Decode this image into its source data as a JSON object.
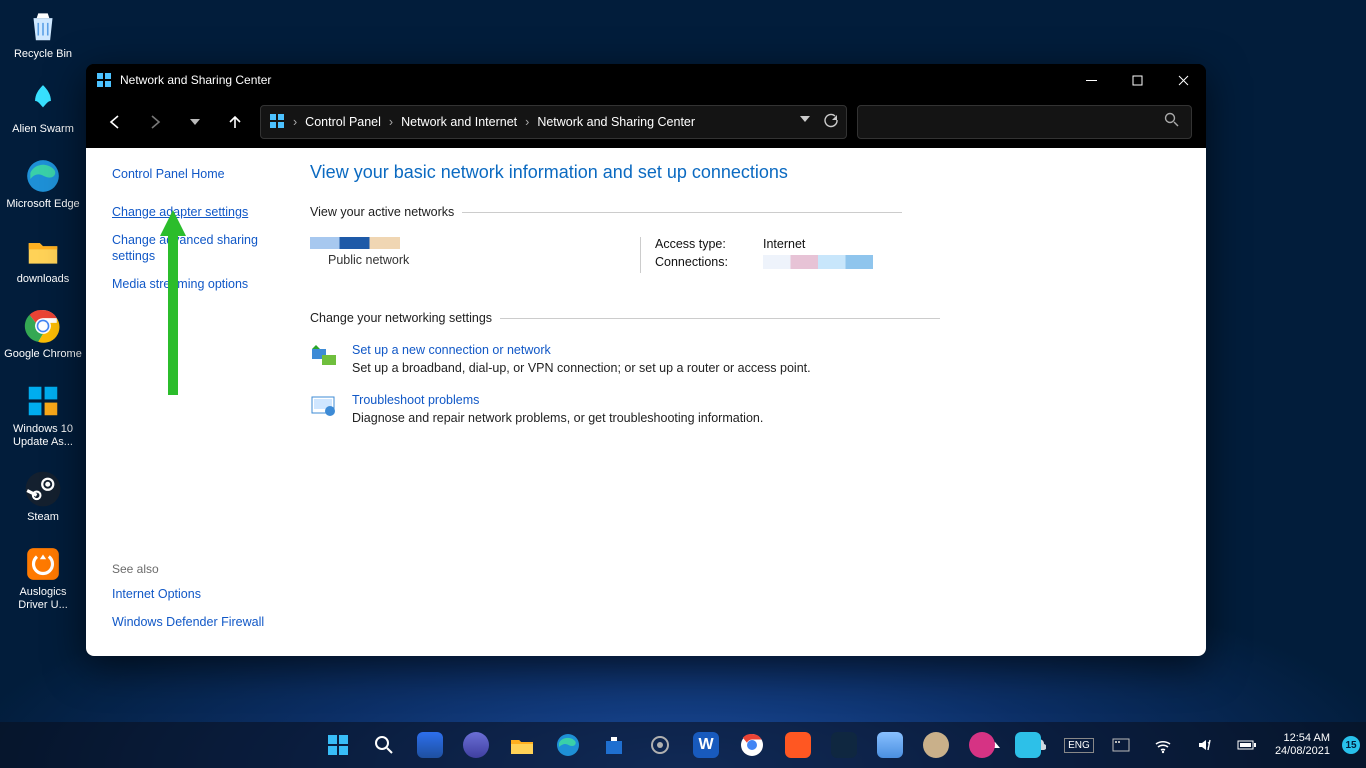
{
  "desktop": {
    "icons": [
      {
        "name": "recycle-bin",
        "label": "Recycle Bin"
      },
      {
        "name": "alien-swarm",
        "label": "Alien Swarm"
      },
      {
        "name": "microsoft-edge",
        "label": "Microsoft Edge"
      },
      {
        "name": "downloads-folder",
        "label": "downloads"
      },
      {
        "name": "google-chrome",
        "label": "Google Chrome"
      },
      {
        "name": "windows-update-assistant",
        "label": "Windows 10 Update As..."
      },
      {
        "name": "steam",
        "label": "Steam"
      },
      {
        "name": "auslogics-driver",
        "label": "Auslogics Driver U..."
      }
    ]
  },
  "window": {
    "title": "Network and Sharing Center",
    "breadcrumbs": [
      "Control Panel",
      "Network and Internet",
      "Network and Sharing Center"
    ]
  },
  "sidebar": {
    "home": "Control Panel Home",
    "links": [
      "Change adapter settings",
      "Change advanced sharing settings",
      "Media streaming options"
    ],
    "see_also_label": "See also",
    "see_also": [
      "Internet Options",
      "Windows Defender Firewall"
    ]
  },
  "main": {
    "heading": "View your basic network information and set up connections",
    "active_networks_label": "View your active networks",
    "network_type": "Public network",
    "access_type_label": "Access type:",
    "access_type_value": "Internet",
    "connections_label": "Connections:",
    "change_settings_label": "Change your networking settings",
    "setup": {
      "title": "Set up a new connection or network",
      "desc": "Set up a broadband, dial-up, or VPN connection; or set up a router or access point."
    },
    "troubleshoot": {
      "title": "Troubleshoot problems",
      "desc": "Diagnose and repair network problems, or get troubleshooting information."
    }
  },
  "taskbar": {
    "tray": {
      "time": "12:54 AM",
      "date": "24/08/2021",
      "notif_count": "15"
    }
  }
}
